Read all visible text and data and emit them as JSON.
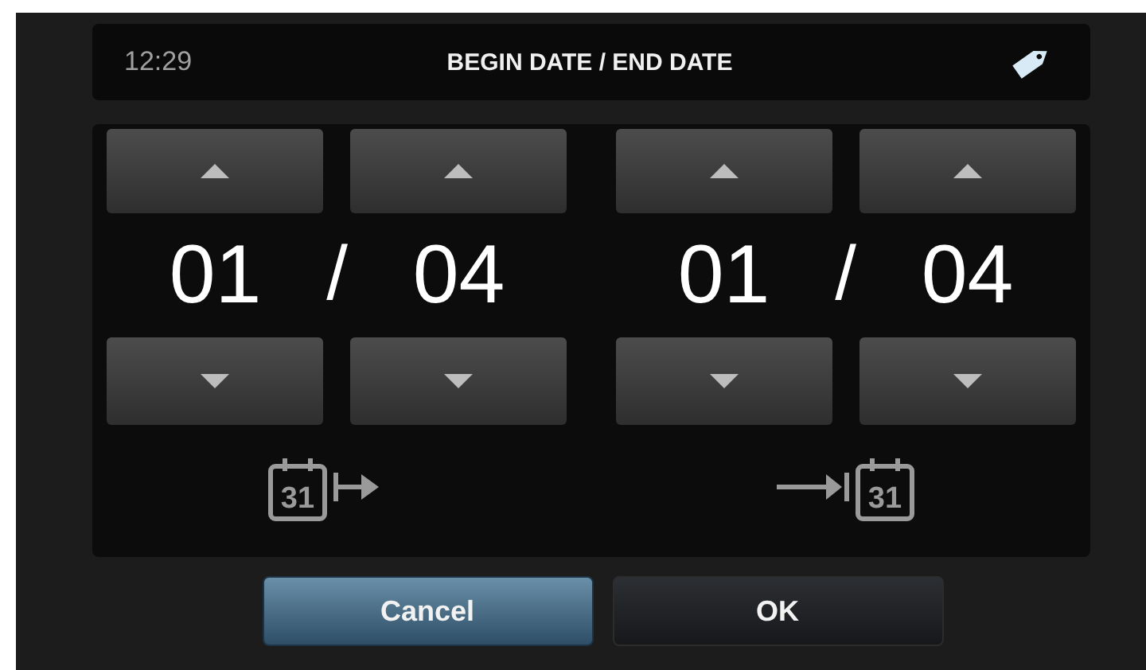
{
  "header": {
    "time": "12:29",
    "title": "BEGIN DATE / END DATE"
  },
  "ranges": [
    {
      "kind": "begin",
      "day": "01",
      "separator": "/",
      "month": "04",
      "calendar_label": "31"
    },
    {
      "kind": "end",
      "day": "01",
      "separator": "/",
      "month": "04",
      "calendar_label": "31"
    }
  ],
  "buttons": [
    {
      "label": "Cancel",
      "selected": true
    },
    {
      "label": "OK",
      "selected": false
    }
  ]
}
